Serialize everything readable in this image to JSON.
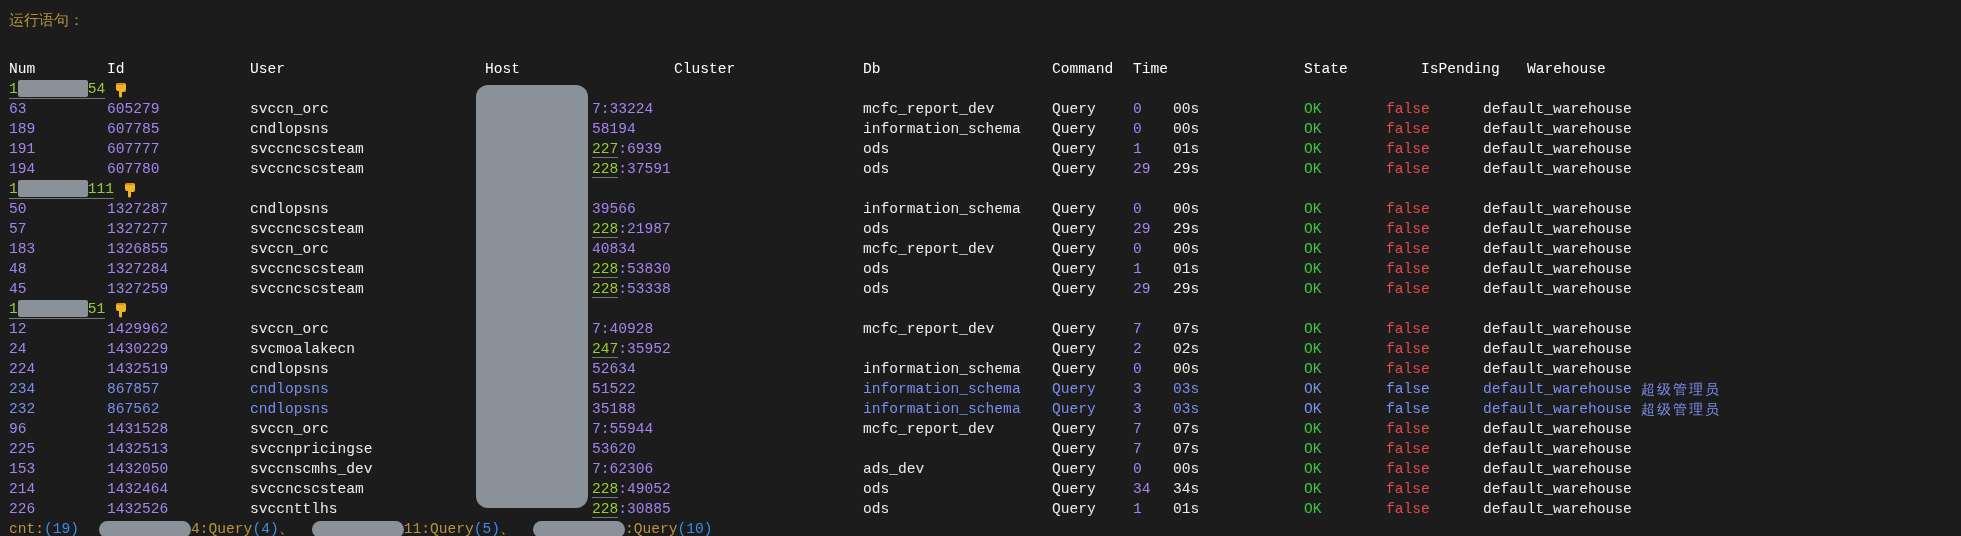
{
  "title": "运行语句：",
  "columns": [
    "Num",
    "Id",
    "User",
    "Host",
    "Cluster",
    "Db",
    "Command",
    "Time",
    "State",
    "IsPending",
    "Warehouse"
  ],
  "groups": [
    {
      "prefix": "1",
      "suffix": "54",
      "rows": [
        {
          "num": "63",
          "id": "605279",
          "user": "svccn_orc",
          "host_mark": "",
          "host": "7:33224",
          "db": "mcfc_report_dev",
          "command": "Query",
          "time": "0",
          "time_text": "00s",
          "state": "OK",
          "pending": "false",
          "warehouse": "default_warehouse",
          "highlighted": false
        },
        {
          "num": "189",
          "id": "607785",
          "user": "cndlopsns",
          "host_mark": "",
          "host": "58194",
          "db": "information_schema",
          "command": "Query",
          "time": "0",
          "time_text": "00s",
          "state": "OK",
          "pending": "false",
          "warehouse": "default_warehouse",
          "highlighted": false
        },
        {
          "num": "191",
          "id": "607777",
          "user": "svccncscsteam",
          "host_mark": "227",
          "host": ":6939",
          "db": "ods",
          "command": "Query",
          "time": "1",
          "time_text": "01s",
          "state": "OK",
          "pending": "false",
          "warehouse": "default_warehouse",
          "highlighted": false
        },
        {
          "num": "194",
          "id": "607780",
          "user": "svccncscsteam",
          "host_mark": "228",
          "host": ":37591",
          "db": "ods",
          "command": "Query",
          "time": "29",
          "time_text": "29s",
          "state": "OK",
          "pending": "false",
          "warehouse": "default_warehouse",
          "highlighted": false
        }
      ]
    },
    {
      "prefix": "1",
      "suffix": "111",
      "rows": [
        {
          "num": "50",
          "id": "1327287",
          "user": "cndlopsns",
          "host_mark": "",
          "host": "39566",
          "db": "information_schema",
          "command": "Query",
          "time": "0",
          "time_text": "00s",
          "state": "OK",
          "pending": "false",
          "warehouse": "default_warehouse",
          "highlighted": false
        },
        {
          "num": "57",
          "id": "1327277",
          "user": "svccncscsteam",
          "host_mark": "228",
          "host": ":21987",
          "db": "ods",
          "command": "Query",
          "time": "29",
          "time_text": "29s",
          "state": "OK",
          "pending": "false",
          "warehouse": "default_warehouse",
          "highlighted": false
        },
        {
          "num": "183",
          "id": "1326855",
          "user": "svccn_orc",
          "host_mark": "",
          "host": "40834",
          "db": "mcfc_report_dev",
          "command": "Query",
          "time": "0",
          "time_text": "00s",
          "state": "OK",
          "pending": "false",
          "warehouse": "default_warehouse",
          "highlighted": false
        },
        {
          "num": "48",
          "id": "1327284",
          "user": "svccncscsteam",
          "host_mark": "228",
          "host": ":53830",
          "db": "ods",
          "command": "Query",
          "time": "1",
          "time_text": "01s",
          "state": "OK",
          "pending": "false",
          "warehouse": "default_warehouse",
          "highlighted": false
        },
        {
          "num": "45",
          "id": "1327259",
          "user": "svccncscsteam",
          "host_mark": "228",
          "host": ":53338",
          "db": "ods",
          "command": "Query",
          "time": "29",
          "time_text": "29s",
          "state": "OK",
          "pending": "false",
          "warehouse": "default_warehouse",
          "highlighted": false
        }
      ]
    },
    {
      "prefix": "1",
      "suffix": "51",
      "rows": [
        {
          "num": "12",
          "id": "1429962",
          "user": "svccn_orc",
          "host_mark": "",
          "host": "7:40928",
          "db": "mcfc_report_dev",
          "command": "Query",
          "time": "7",
          "time_text": "07s",
          "state": "OK",
          "pending": "false",
          "warehouse": "default_warehouse",
          "highlighted": false
        },
        {
          "num": "24",
          "id": "1430229",
          "user": "svcmoalakecn",
          "host_mark": "247",
          "host": ":35952",
          "command": "Query",
          "time": "2",
          "time_text": "02s",
          "state": "OK",
          "pending": "false",
          "warehouse": "default_warehouse",
          "highlighted": false
        },
        {
          "num": "224",
          "id": "1432519",
          "user": "cndlopsns",
          "host_mark": "",
          "host": "52634",
          "db": "information_schema",
          "command": "Query",
          "time": "0",
          "time_text": "00s",
          "state": "OK",
          "pending": "false",
          "warehouse": "default_warehouse",
          "highlighted": false
        },
        {
          "num": "234",
          "id": "867857",
          "user": "cndlopsns",
          "host_mark": "",
          "host": "51522",
          "db": "information_schema",
          "command": "Query",
          "time": "3",
          "time_text": "03s",
          "state": "OK",
          "pending": "false",
          "warehouse": "default_warehouse",
          "role": "超级管理员",
          "highlighted": true
        },
        {
          "num": "232",
          "id": "867562",
          "user": "cndlopsns",
          "host_mark": "",
          "host": "35188",
          "db": "information_schema",
          "command": "Query",
          "time": "3",
          "time_text": "03s",
          "state": "OK",
          "pending": "false",
          "warehouse": "default_warehouse",
          "role": "超级管理员",
          "highlighted": true
        },
        {
          "num": "96",
          "id": "1431528",
          "user": "svccn_orc",
          "host_mark": "",
          "host": "7:55944",
          "db": "mcfc_report_dev",
          "command": "Query",
          "time": "7",
          "time_text": "07s",
          "state": "OK",
          "pending": "false",
          "warehouse": "default_warehouse",
          "highlighted": false
        },
        {
          "num": "225",
          "id": "1432513",
          "user": "svccnpricingse",
          "host_mark": "",
          "host": "53620",
          "command": "Query",
          "time": "7",
          "time_text": "07s",
          "state": "OK",
          "pending": "false",
          "warehouse": "default_warehouse",
          "highlighted": false
        },
        {
          "num": "153",
          "id": "1432050",
          "user": "svccnscmhs_dev",
          "host_mark": "",
          "host": "7:62306",
          "db": "ads_dev",
          "command": "Query",
          "time": "0",
          "time_text": "00s",
          "state": "OK",
          "pending": "false",
          "warehouse": "default_warehouse",
          "highlighted": false
        },
        {
          "num": "214",
          "id": "1432464",
          "user": "svccncscsteam",
          "host_mark": "228",
          "host": ":49052",
          "db": "ods",
          "command": "Query",
          "time": "34",
          "time_text": "34s",
          "state": "OK",
          "pending": "false",
          "warehouse": "default_warehouse",
          "highlighted": false
        },
        {
          "num": "226",
          "id": "1432526",
          "user": "svccnttlhs",
          "host_mark": "228",
          "host": ":30885",
          "db": "ods",
          "command": "Query",
          "time": "1",
          "time_text": "01s",
          "state": "OK",
          "pending": "false",
          "warehouse": "default_warehouse",
          "highlighted": false
        }
      ]
    }
  ],
  "summary": {
    "label": "cnt:",
    "count": "(19)",
    "items": [
      {
        "text": "4:Query",
        "count": "(4)",
        "sep": "、"
      },
      {
        "text": "11:Query",
        "count": "(5)",
        "sep": "、"
      },
      {
        "text": ":Query",
        "count": "(10)"
      }
    ]
  }
}
